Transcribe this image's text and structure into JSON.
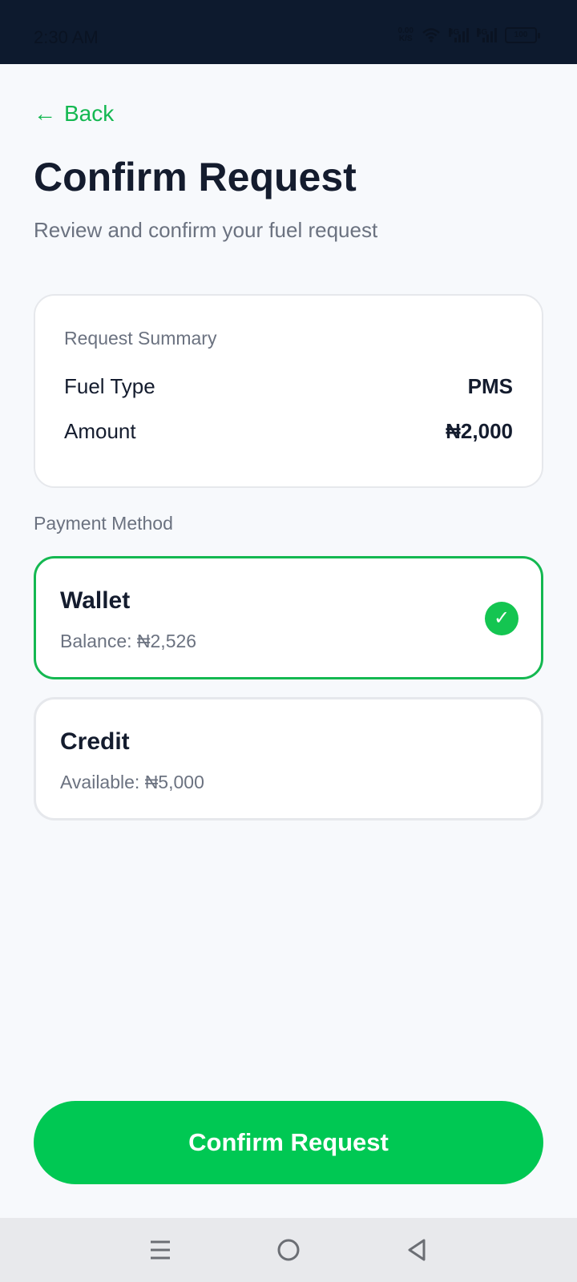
{
  "status_bar": {
    "time": "2:30 AM",
    "net_speed_value": "0.00",
    "net_speed_unit": "K/S",
    "signal_1_label": "4G",
    "signal_2_label": "4G",
    "battery": "100"
  },
  "header": {
    "back_arrow": "←",
    "back_label": "Back",
    "title": "Confirm Request",
    "subtitle": "Review and confirm your fuel request"
  },
  "summary": {
    "heading": "Request Summary",
    "rows": [
      {
        "label": "Fuel Type",
        "value": "PMS"
      },
      {
        "label": "Amount",
        "value": "₦2,000"
      }
    ]
  },
  "payment": {
    "label": "Payment Method",
    "options": [
      {
        "title": "Wallet",
        "detail": "Balance: ₦2,526",
        "selected": true,
        "check": "✓"
      },
      {
        "title": "Credit",
        "detail": "Available: ₦5,000",
        "selected": false
      }
    ]
  },
  "actions": {
    "confirm_label": "Confirm Request"
  },
  "colors": {
    "accent": "#00c853",
    "status_bar_bg": "#0d1a2e",
    "background": "#f7f9fc"
  },
  "icons": {
    "back": "arrow-left-icon",
    "check": "check-circle-icon",
    "nav_menu": "menu-icon",
    "nav_home": "home-circle-icon",
    "nav_back": "triangle-back-icon"
  }
}
